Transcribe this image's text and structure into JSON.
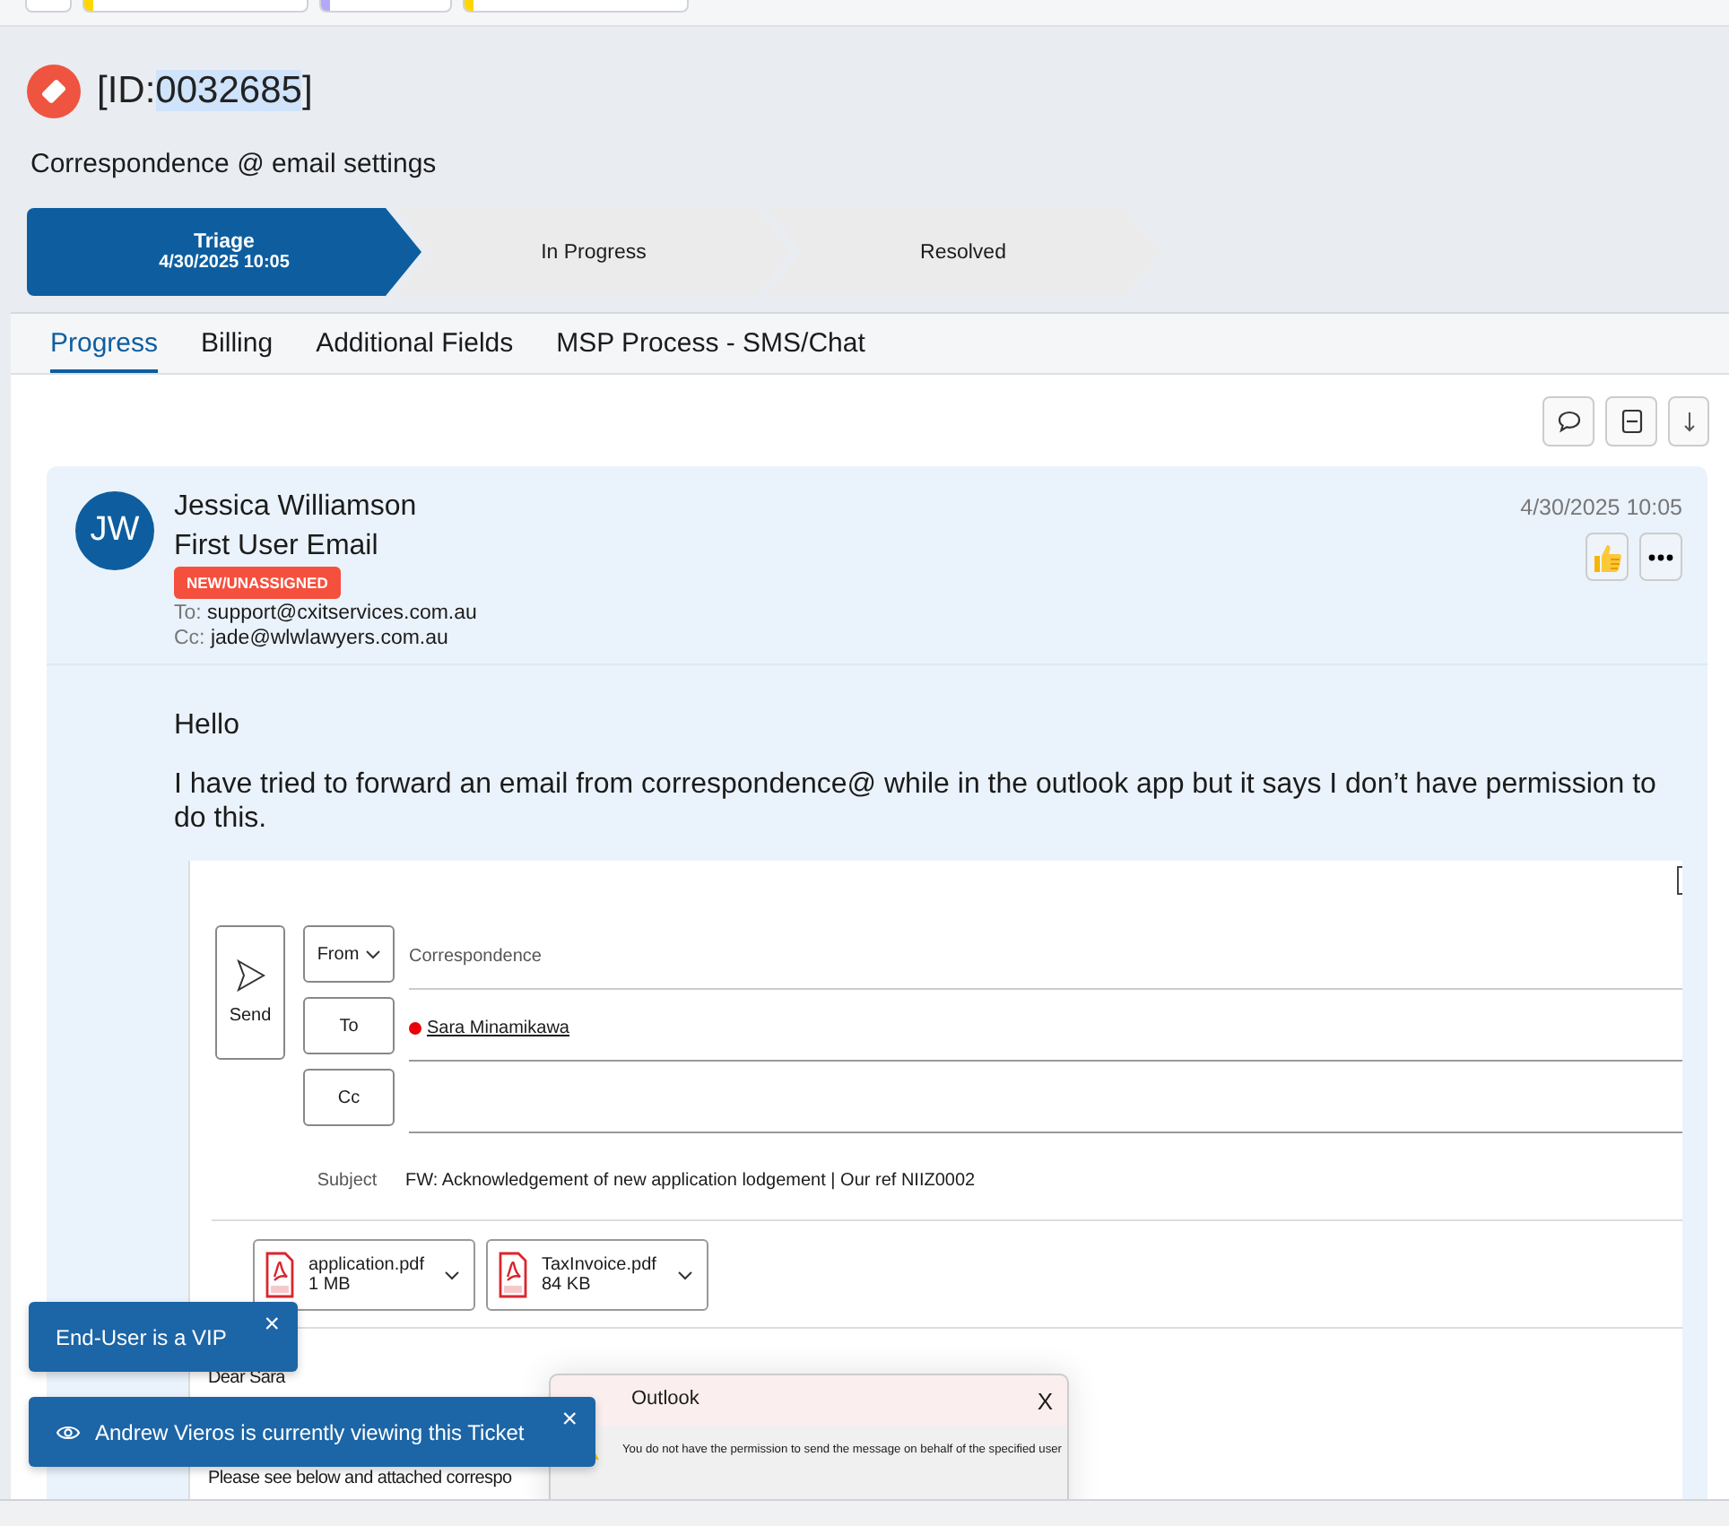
{
  "top_tabs": [
    {
      "kind": "blank"
    },
    {
      "kind": "tagged",
      "color": "#ffd600"
    },
    {
      "kind": "tagged",
      "color": "#b4a7f5"
    },
    {
      "kind": "tagged",
      "color": "#ffd600"
    }
  ],
  "ticket": {
    "id_open": "[ID:",
    "id_number": "0032685",
    "id_close": "]",
    "id_highlighted": true,
    "title": "Correspondence @ email settings"
  },
  "stages": [
    {
      "label": "Triage",
      "date": "4/30/2025 10:05",
      "selected": true
    },
    {
      "label": "In Progress",
      "selected": false
    },
    {
      "label": "Resolved",
      "selected": false
    }
  ],
  "tabs": [
    {
      "label": "Progress",
      "selected": true
    },
    {
      "label": "Billing",
      "selected": false
    },
    {
      "label": "Additional Fields",
      "selected": false
    },
    {
      "label": "MSP Process - SMS/Chat",
      "selected": false
    }
  ],
  "email": {
    "initials": "JW",
    "sender": "Jessica Williamson",
    "subject": "First User Email",
    "badge": "NEW/UNASSIGNED",
    "to_label": "To:",
    "to": "support@cxitservices.com.au",
    "cc_label": "Cc:",
    "cc": "jade@wlwlawyers.com.au",
    "date": "4/30/2025 10:05",
    "body": [
      "Hello",
      "I have tried to forward an email from correspondence@ while in the outlook app but it says I don’t have permission to do this."
    ],
    "screenshot": {
      "send_label": "Send",
      "from_label": "From",
      "to_label": "To",
      "cc_label": "Cc",
      "from_value": "Correspondence",
      "recipient": "Sara Minamikawa",
      "subject_label": "Subject",
      "subject": "FW: Acknowledgement of new application lodgement | Our ref NIIZ0002",
      "attachments": [
        {
          "name": "application.pdf",
          "size": "1 MB"
        },
        {
          "name": "TaxInvoice.pdf",
          "size": "84 KB"
        }
      ],
      "body": [
        "Dear Sara",
        "Please see below and attached correspo"
      ],
      "dialog": {
        "title": "Outlook",
        "close": "X",
        "message": "You do not have the permission to send the message on behalf of the specified user"
      }
    }
  },
  "toasts": [
    {
      "kind": "plain",
      "text": "End-User is a VIP",
      "close": "×"
    },
    {
      "kind": "viewer",
      "text": "Andrew Vieros is currently viewing this Ticket",
      "close": "×"
    }
  ]
}
